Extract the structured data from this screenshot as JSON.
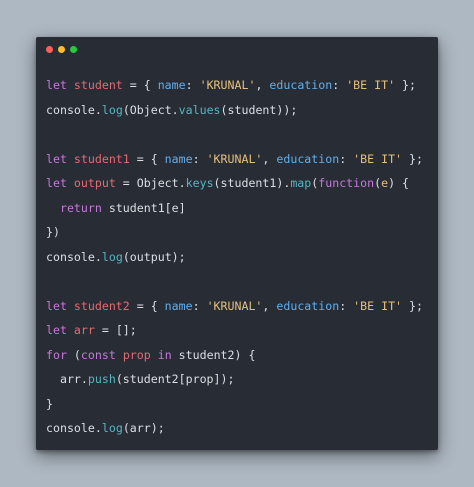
{
  "window": {
    "controls": [
      {
        "name": "close-dot",
        "color": "#ff5f56"
      },
      {
        "name": "minimize-dot",
        "color": "#ffbd2e"
      },
      {
        "name": "maximize-dot",
        "color": "#27c93f"
      }
    ]
  },
  "colors": {
    "plain": "#dcdfe4",
    "keyword": "#c678dd",
    "variable": "#e06c75",
    "property": "#61afef",
    "string": "#e5c07b",
    "function": "#61afef",
    "param": "#e5c07b",
    "method": "#56b6c2"
  },
  "code": {
    "lines": [
      [
        [
          "keyword",
          "let "
        ],
        [
          "variable",
          "student"
        ],
        [
          "plain",
          " = { "
        ],
        [
          "property",
          "name"
        ],
        [
          "plain",
          ": "
        ],
        [
          "string",
          "'KRUNAL'"
        ],
        [
          "plain",
          ", "
        ],
        [
          "property",
          "education"
        ],
        [
          "plain",
          ": "
        ],
        [
          "string",
          "'BE IT'"
        ],
        [
          "plain",
          " };"
        ]
      ],
      [
        [
          "plain",
          "console"
        ],
        [
          "plain",
          "."
        ],
        [
          "method",
          "log"
        ],
        [
          "plain",
          "(Object."
        ],
        [
          "method",
          "values"
        ],
        [
          "plain",
          "(student));"
        ]
      ],
      [],
      [
        [
          "keyword",
          "let "
        ],
        [
          "variable",
          "student1"
        ],
        [
          "plain",
          " = { "
        ],
        [
          "property",
          "name"
        ],
        [
          "plain",
          ": "
        ],
        [
          "string",
          "'KRUNAL'"
        ],
        [
          "plain",
          ", "
        ],
        [
          "property",
          "education"
        ],
        [
          "plain",
          ": "
        ],
        [
          "string",
          "'BE IT'"
        ],
        [
          "plain",
          " };"
        ]
      ],
      [
        [
          "keyword",
          "let "
        ],
        [
          "variable",
          "output"
        ],
        [
          "plain",
          " = Object."
        ],
        [
          "method",
          "keys"
        ],
        [
          "plain",
          "(student1)."
        ],
        [
          "method",
          "map"
        ],
        [
          "plain",
          "("
        ],
        [
          "keyword",
          "function"
        ],
        [
          "plain",
          "("
        ],
        [
          "param",
          "e"
        ],
        [
          "plain",
          ") {"
        ]
      ],
      [
        [
          "plain",
          "  "
        ],
        [
          "keyword",
          "return"
        ],
        [
          "plain",
          " student1[e]"
        ]
      ],
      [
        [
          "plain",
          "})"
        ]
      ],
      [
        [
          "plain",
          "console"
        ],
        [
          "plain",
          "."
        ],
        [
          "method",
          "log"
        ],
        [
          "plain",
          "(output);"
        ]
      ],
      [],
      [
        [
          "keyword",
          "let "
        ],
        [
          "variable",
          "student2"
        ],
        [
          "plain",
          " = { "
        ],
        [
          "property",
          "name"
        ],
        [
          "plain",
          ": "
        ],
        [
          "string",
          "'KRUNAL'"
        ],
        [
          "plain",
          ", "
        ],
        [
          "property",
          "education"
        ],
        [
          "plain",
          ": "
        ],
        [
          "string",
          "'BE IT'"
        ],
        [
          "plain",
          " };"
        ]
      ],
      [
        [
          "keyword",
          "let "
        ],
        [
          "variable",
          "arr"
        ],
        [
          "plain",
          " = [];"
        ]
      ],
      [
        [
          "keyword",
          "for"
        ],
        [
          "plain",
          " ("
        ],
        [
          "keyword",
          "const"
        ],
        [
          "plain",
          " "
        ],
        [
          "variable",
          "prop"
        ],
        [
          "plain",
          " "
        ],
        [
          "keyword",
          "in"
        ],
        [
          "plain",
          " student2) {"
        ]
      ],
      [
        [
          "plain",
          "  arr."
        ],
        [
          "method",
          "push"
        ],
        [
          "plain",
          "(student2[prop]);"
        ]
      ],
      [
        [
          "plain",
          "}"
        ]
      ],
      [
        [
          "plain",
          "console"
        ],
        [
          "plain",
          "."
        ],
        [
          "method",
          "log"
        ],
        [
          "plain",
          "(arr);"
        ]
      ]
    ]
  }
}
